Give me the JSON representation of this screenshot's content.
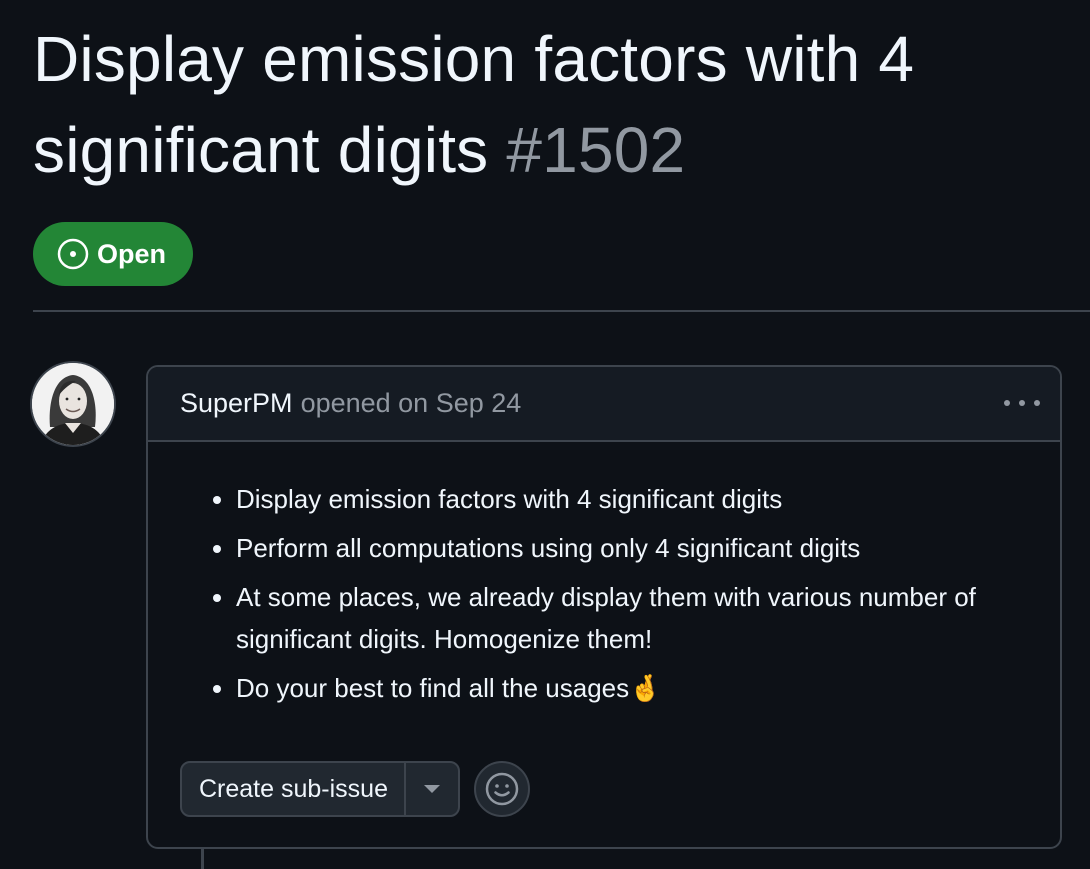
{
  "issue": {
    "title": "Display emission factors with 4 significant digits",
    "number": "#1502",
    "state": "Open",
    "state_color": "#238636"
  },
  "comment": {
    "author": "SuperPM",
    "meta": "opened on Sep 24",
    "body_items": [
      "Display emission factors with 4 significant digits",
      "Perform all computations using only 4 significant digits",
      "At some places, we already display them with various number of significant digits. Homogenize them!",
      "Do your best to find all the usages🤞"
    ],
    "more_icon": "kebab-horizontal-icon"
  },
  "actions": {
    "create_subissue_label": "Create sub-issue",
    "dropdown_icon": "triangle-down-icon",
    "reaction_icon": "smiley-icon"
  },
  "colors": {
    "background": "#0d1117",
    "border": "#3d444d",
    "muted_text": "#9198a1",
    "open_green": "#238636"
  }
}
